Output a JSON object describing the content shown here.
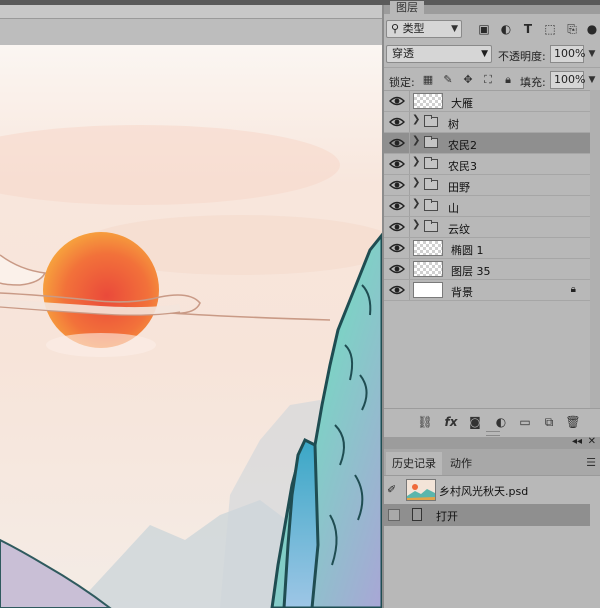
{
  "layers_panel": {
    "tab_label": "图层",
    "kind_filter": "类型",
    "filter_icons": [
      "image-filter-icon",
      "adjustment-filter-icon",
      "type-filter-icon",
      "shape-filter-icon",
      "smart-object-filter-icon"
    ],
    "blend_mode": "穿透",
    "opacity_label": "不透明度:",
    "opacity_value": "100%",
    "lock_label": "锁定:",
    "fill_label": "填充:",
    "fill_value": "100%",
    "layers": [
      {
        "name": "大雁",
        "kind": "layer",
        "thumb": "transparent",
        "visible": true
      },
      {
        "name": "树",
        "kind": "group",
        "visible": true
      },
      {
        "name": "农民2",
        "kind": "group",
        "visible": true,
        "selected": true
      },
      {
        "name": "农民3",
        "kind": "group",
        "visible": true
      },
      {
        "name": "田野",
        "kind": "group",
        "visible": true
      },
      {
        "name": "山",
        "kind": "group",
        "visible": true
      },
      {
        "name": "云纹",
        "kind": "group",
        "visible": true
      },
      {
        "name": "椭圆 1",
        "kind": "layer",
        "thumb": "transparent",
        "visible": true
      },
      {
        "name": "图层 35",
        "kind": "layer",
        "thumb": "transparent",
        "visible": true
      },
      {
        "name": "背景",
        "kind": "layer",
        "thumb": "white",
        "visible": true,
        "locked": true
      }
    ],
    "bottom_icons": [
      "link-icon",
      "fx-icon",
      "mask-icon",
      "adjustment-icon",
      "new-group-icon",
      "new-layer-icon",
      "trash-icon"
    ],
    "fx_label": "fx"
  },
  "history_panel": {
    "tabs": [
      {
        "label": "历史记录",
        "active": true
      },
      {
        "label": "动作",
        "active": false
      }
    ],
    "snapshot_name": "乡村风光秋天.psd",
    "states": [
      {
        "name": "打开",
        "selected": true
      }
    ]
  },
  "colors": {
    "panel_bg": "#b8b8b8",
    "selected_row": "#8f8f8f",
    "sun_center": "#ee5a3a",
    "sun_edge": "#f5a33a",
    "sky_top": "#f7efe9",
    "sky_glow": "#f6dccf",
    "mountain_teal": "#6ec7c2",
    "mountain_outline": "#1f4d52"
  }
}
